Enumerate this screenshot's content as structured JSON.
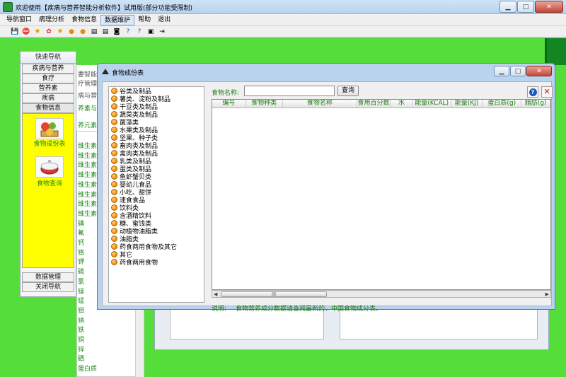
{
  "app": {
    "title": "欢迎使用【疾病与营养智能分析软件】试用版(部分功能受限制)"
  },
  "menu": {
    "items": [
      "导航窗口",
      "病理分析",
      "食物信息",
      "数据维护",
      "帮助",
      "退出"
    ]
  },
  "toolbar": {
    "icons": [
      "save-icon",
      "stop-icon",
      "star-icon",
      "flower-icon",
      "star-icon",
      "fruit-icon",
      "fruit-icon",
      "book-icon",
      "book-icon",
      "camera-icon",
      "help-icon",
      "help-icon",
      "window-icon",
      "exit-icon"
    ]
  },
  "nav": {
    "header": "快速导航",
    "buttons": [
      "疾病与营养",
      "食疗",
      "营养素",
      "疾病",
      "食物信息"
    ],
    "content_items": [
      {
        "label": "食物成份表"
      },
      {
        "label": "食物查询"
      }
    ],
    "bottom_buttons": [
      "数据管理",
      "关闭导航"
    ]
  },
  "background": {
    "labels": [
      "要智能",
      "疗管理",
      "病与营",
      "养素与",
      "养元素"
    ],
    "list": [
      "维生素",
      "维生素",
      "维生素",
      "维生素",
      "维生素",
      "维生素",
      "维生素",
      "维生素",
      "碘",
      "氟",
      "钙",
      "铬",
      "钾",
      "磷",
      "氯",
      "镁",
      "锰",
      "钼",
      "钠",
      "铁",
      "铜",
      "锌",
      "硒",
      "蛋白质"
    ]
  },
  "dialog": {
    "title": "食物成份表",
    "tree": [
      "谷类及制品",
      "薯类、淀粉及制品",
      "干豆类及制品",
      "蔬菜类及制品",
      "菌藻类",
      "水果类及制品",
      "坚果、种子类",
      "畜肉类及制品",
      "禽肉类及制品",
      "乳类及制品",
      "蛋类及制品",
      "鱼虾蟹贝类",
      "婴幼儿食品",
      "小吃、甜饼",
      "速食食品",
      "饮料类",
      "含酒精饮料",
      "糖、蜜饯类",
      "动植物油脂类",
      "油脂类",
      "药食两用食物及其它",
      "其它",
      "药食两用食物"
    ],
    "search": {
      "label": "食物名称:",
      "value": "",
      "button": "查询"
    },
    "columns": [
      "编号",
      "食物种类",
      "食物名称",
      "食用百分数",
      "水",
      "能量(KCAL)",
      "能量(KJ)",
      "蛋白质(g)",
      "脂肪(g)"
    ],
    "hscroll_label": "III",
    "note_label": "说明:",
    "note_text": "食物营养成分数据请查阅最新的，中国食物成分表。"
  }
}
